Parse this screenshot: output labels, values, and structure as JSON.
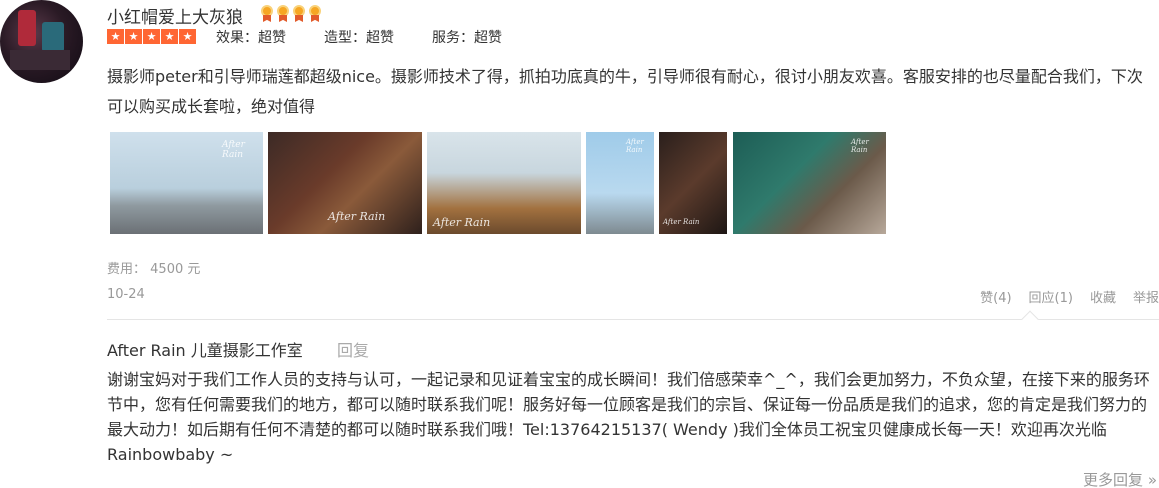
{
  "user": {
    "name": "小红帽爱上大灰狼",
    "medal_count": 4
  },
  "rating": {
    "stars": 5,
    "scores": [
      "效果：超赞",
      "造型：超赞",
      "服务：超赞"
    ]
  },
  "review": {
    "text": "摄影师peter和引导师瑞莲都超级nice。摄影师技术了得，抓拍功底真的牛，引导师很有耐心，很讨小朋友欢喜。客服安排的也尽量配合我们，下次可以购买成长套啦，绝对值得",
    "photo_watermark": "After Rain",
    "fee_label": "费用：",
    "fee_value": "4500 元",
    "date": "10-24"
  },
  "actions": {
    "like": "赞(4)",
    "reply": "回应(1)",
    "favorite": "收藏",
    "report": "举报"
  },
  "merchant_reply": {
    "shop_name": "After Rain 儿童摄影工作室",
    "reply_label": "回复",
    "text": "谢谢宝妈对于我们工作人员的支持与认可，一起记录和见证着宝宝的成长瞬间！我们倍感荣幸^_^，我们会更加努力，不负众望，在接下来的服务环节中，您有任何需要我们的地方，都可以随时联系我们呢！服务好每一位顾客是我们的宗旨、保证每一份品质是我们的追求，您的肯定是我们努力的最大动力！如后期有任何不清楚的都可以随时联系我们哦！Tel:13764215137( Wendy )我们全体员工祝宝贝健康成长每一天！欢迎再次光临Rainbowbaby ~"
  },
  "more_replies": "更多回复 »",
  "colors": {
    "star": "#ff6633",
    "muted": "#999999",
    "text": "#333333"
  }
}
